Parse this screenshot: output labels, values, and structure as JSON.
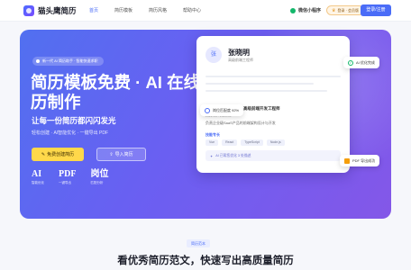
{
  "header": {
    "logo_text": "猫头鹰简历",
    "nav": [
      "首页",
      "简历模板",
      "简历风格",
      "帮助中心"
    ],
    "mini_program": "微信小程序",
    "vip_label": "登录 · 会员版",
    "login_button": "登录/注册"
  },
  "hero": {
    "badge": "新一代 AI 简历助手 · 智能快速求职",
    "title": "简历模板免费 · AI 在线简历制作",
    "subtitle": "让每一份简历都闪闪发光",
    "description": "轻松创建 · AI智能优化 · 一键导出 PDF",
    "primary_button": "免费创建简历",
    "secondary_button": "导入简历",
    "stats": [
      {
        "value": "AI",
        "label": "智能优化"
      },
      {
        "value": "PDF",
        "label": "一键导出"
      },
      {
        "value": "岗位",
        "label": "匹配分析"
      }
    ]
  },
  "resume_card": {
    "avatar": "张",
    "name": "张晓明",
    "role": "高级前端工程师",
    "job_title": "高级前端开发工程师",
    "date": "2022.03 - 2024.06",
    "text": "负责企业级SaaS产品的前端架构设计与开发",
    "skills_title": "技能专长",
    "skills": [
      "Vue",
      "React",
      "TypeScript",
      "Node.js"
    ],
    "ai_hint": "AI 已帮您优化 3 处描述"
  },
  "chips": {
    "ai_done": "AI 优化完成",
    "match": "岗位匹配度 92%",
    "pdf": "PDF 导出成功"
  },
  "section": {
    "badge": "简历范本",
    "title": "看优秀简历范文，快速写出高质量简历"
  }
}
